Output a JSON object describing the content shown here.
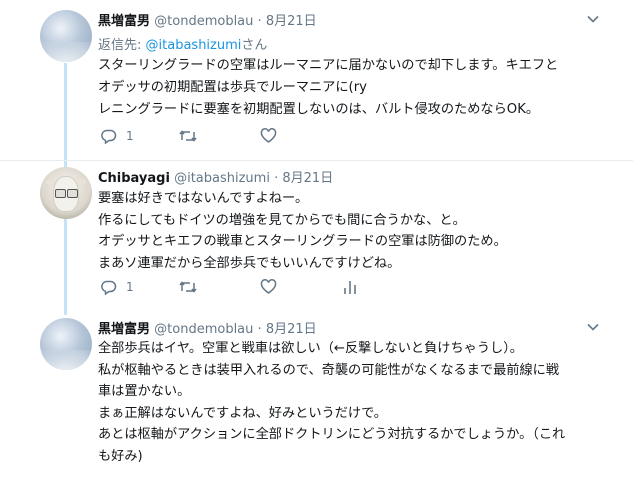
{
  "tweets": [
    {
      "name": "黒増富男",
      "handle": "@tondemoblau",
      "dot": "·",
      "date": "8月21日",
      "reply_prefix": "返信先:",
      "reply_handle": "@itabashizumi",
      "reply_suffix": "さん",
      "lines": [
        "スターリングラードの空軍はルーマニアに届かないので却下します。キエフと",
        "オデッサの初期配置は歩兵でルーマニアに(ry",
        "レニングラードに要塞を初期配置しないのは、バルト侵攻のためならOK。"
      ],
      "reply_count": "1",
      "avatar_icon": "sky-photo-avatar"
    },
    {
      "name": "Chibayagi",
      "handle": "@itabashizumi",
      "dot": "·",
      "date": "8月21日",
      "lines": [
        "要塞は好きではないんですよねー。",
        "作るにしてもドイツの増強を見てからでも間に合うかな、と。",
        "オデッサとキエフの戦車とスターリングラードの空軍は防御のため。",
        "まあソ連軍だから全部歩兵でもいいんですけどね。"
      ],
      "reply_count": "1",
      "avatar_icon": "goat-with-glasses-avatar"
    },
    {
      "name": "黒増富男",
      "handle": "@tondemoblau",
      "dot": "·",
      "date": "8月21日",
      "lines": [
        "全部歩兵はイヤ。空軍と戦車は欲しい（←反撃しないと負けちゃうし）。",
        "私が枢軸やるときは装甲入れるので、奇襲の可能性がなくなるまで最前線に戦",
        "車は置かない。",
        "まぁ正解はないんですよね、好みというだけで。",
        "あとは枢軸がアクションに全部ドクトリンにどう対抗するかでしょうか。（これ",
        "も好み)"
      ],
      "avatar_icon": "sky-photo-avatar"
    }
  ],
  "colors": {
    "text": "#14171a",
    "secondary": "#657786",
    "link": "#1b95e0",
    "thread_line": "#c5e3f7",
    "divider": "#e6ecf0"
  },
  "icons": [
    "chevron-down-icon",
    "reply-icon",
    "retweet-icon",
    "like-icon",
    "analytics-icon"
  ]
}
